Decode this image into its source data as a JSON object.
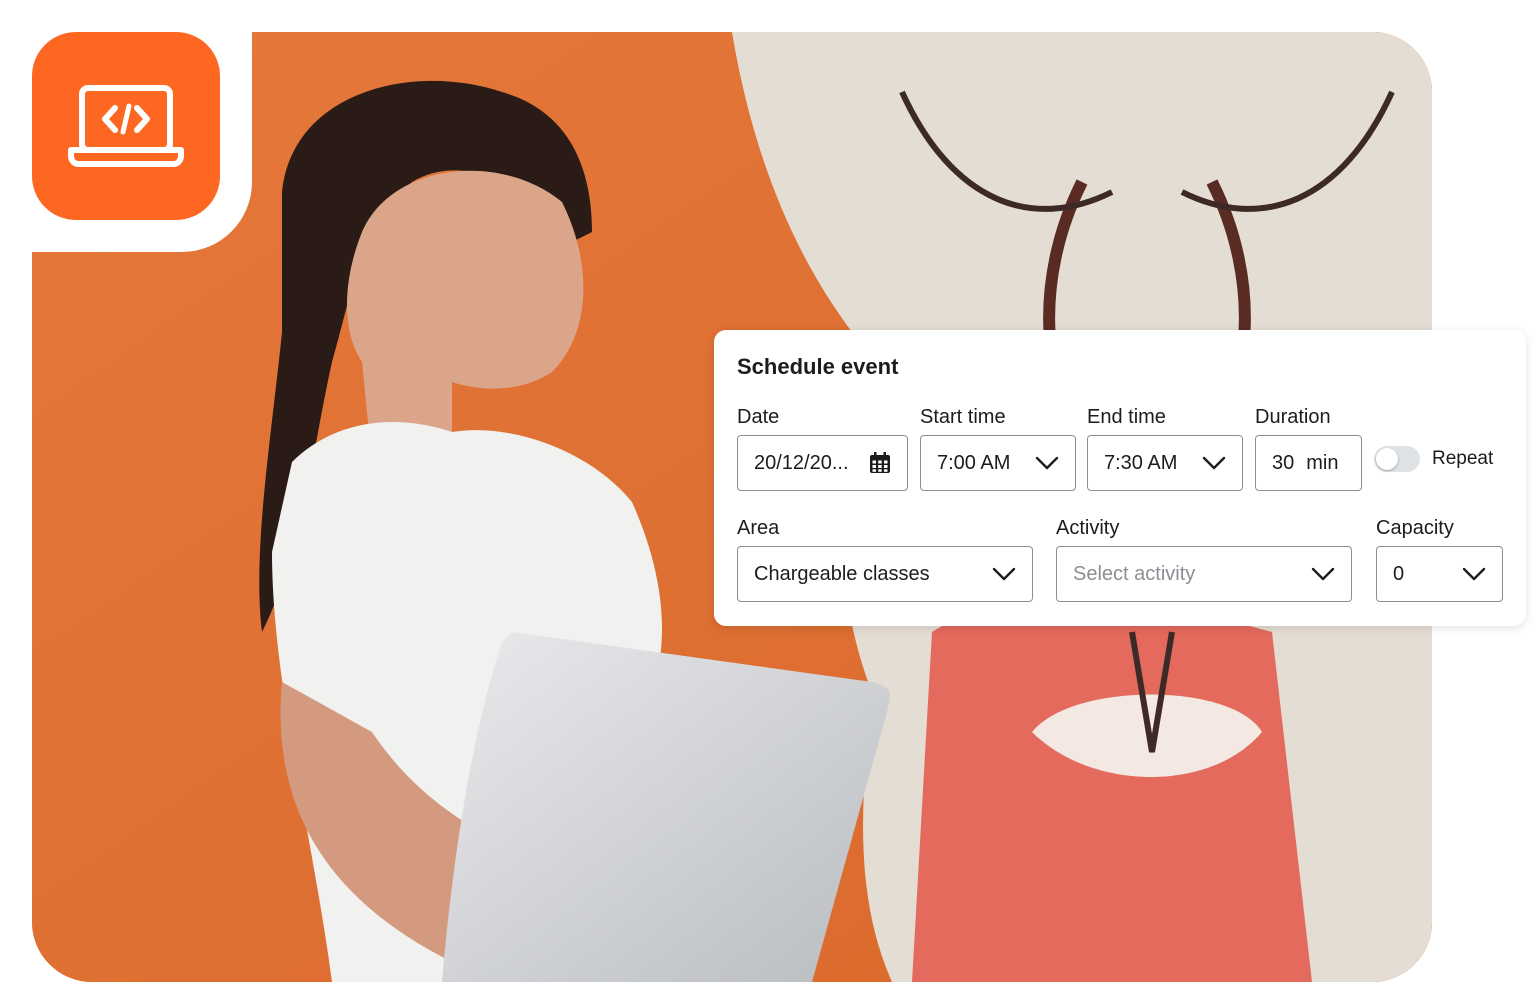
{
  "form": {
    "title": "Schedule event",
    "date": {
      "label": "Date",
      "value": "20/12/20..."
    },
    "start_time": {
      "label": "Start time",
      "value": "7:00 AM"
    },
    "end_time": {
      "label": "End time",
      "value": "7:30 AM"
    },
    "duration": {
      "label": "Duration",
      "value": "30",
      "unit": "min"
    },
    "repeat": {
      "label": "Repeat",
      "enabled": false
    },
    "area": {
      "label": "Area",
      "value": "Chargeable classes"
    },
    "activity": {
      "label": "Activity",
      "placeholder": "Select activity"
    },
    "capacity": {
      "label": "Capacity",
      "value": "0"
    }
  },
  "badge": {
    "icon": "laptop-code-icon",
    "color": "#fe6721"
  },
  "colors": {
    "accent": "#fe6721",
    "background_wall": "#e97a3a"
  }
}
